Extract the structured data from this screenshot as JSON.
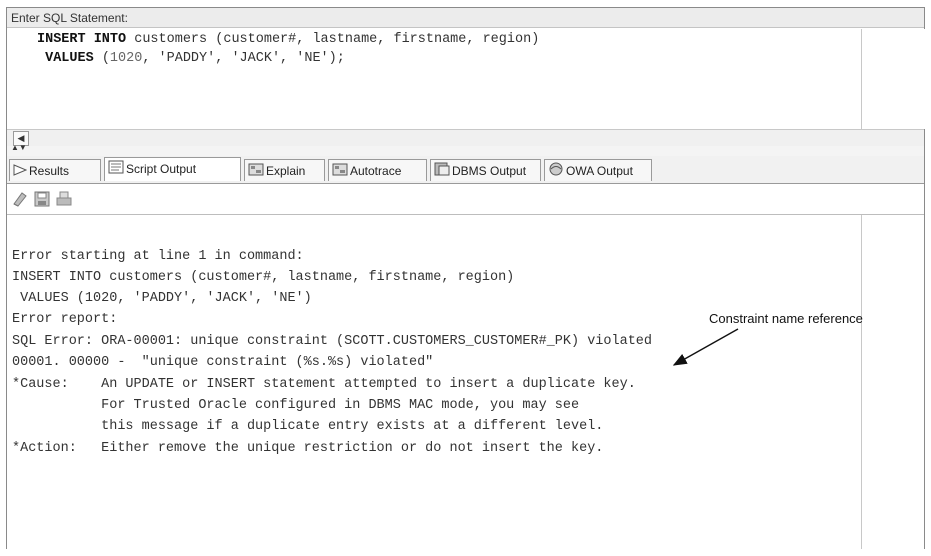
{
  "header": {
    "label": "Enter SQL Statement:"
  },
  "editor": {
    "line1": {
      "keyword": "INSERT INTO",
      "rest": " customers (customer#, lastname, firstname, region)"
    },
    "line2": {
      "keyword": "VALUES",
      "p1": " (",
      "num": "1020",
      "p2": ", 'PADDY', 'JACK', 'NE');"
    }
  },
  "scroll": {
    "arrow": "◀",
    "split": "▲▼"
  },
  "tabs": [
    {
      "label": "Results",
      "icon": "results-play-icon"
    },
    {
      "label": "Script Output",
      "icon": "script-output-icon"
    },
    {
      "label": "Explain",
      "icon": "explain-icon"
    },
    {
      "label": "Autotrace",
      "icon": "autotrace-icon"
    },
    {
      "label": "DBMS Output",
      "icon": "dbms-output-icon"
    },
    {
      "label": "OWA Output",
      "icon": "owa-output-icon"
    }
  ],
  "toolbar": {
    "icons": [
      "eraser-icon",
      "save-icon",
      "print-icon"
    ]
  },
  "output": {
    "lines": [
      "Error starting at line 1 in command:",
      "INSERT INTO customers (customer#, lastname, firstname, region)",
      " VALUES (1020, 'PADDY', 'JACK', 'NE')",
      "Error report:",
      "SQL Error: ORA-00001: unique constraint (SCOTT.CUSTOMERS_CUSTOMER#_PK) violated",
      "00001. 00000 -  \"unique constraint (%s.%s) violated\"",
      "*Cause:    An UPDATE or INSERT statement attempted to insert a duplicate key.",
      "           For Trusted Oracle configured in DBMS MAC mode, you may see",
      "           this message if a duplicate entry exists at a different level.",
      "*Action:   Either remove the unique restriction or do not insert the key."
    ]
  },
  "annotation": {
    "text": "Constraint name reference"
  }
}
